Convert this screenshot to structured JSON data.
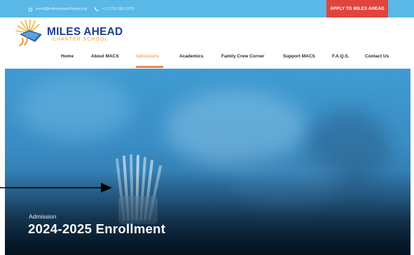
{
  "topbar": {
    "email": "enroll@milesaheadcharter.org",
    "phone": "+1 (770) 560-1670",
    "apply_label": "APPLY TO MILES AHEAD"
  },
  "logo": {
    "name": "MILES AHEAD",
    "subtitle": "CHARTER SCHOOL"
  },
  "nav": {
    "items": [
      {
        "label": "Home"
      },
      {
        "label": "About MACS"
      },
      {
        "label": "Admissions"
      },
      {
        "label": "Academics"
      },
      {
        "label": "Family Crew Corner"
      },
      {
        "label": "Support MACS"
      },
      {
        "label": "F.A.Q.S."
      },
      {
        "label": "Contact Us"
      }
    ],
    "active_index": 2
  },
  "hero": {
    "kicker": "Admission",
    "title": "2024-2025 Enrollment"
  },
  "colors": {
    "topbar": "#5ab8e6",
    "apply_button": "#e2443c",
    "brand_blue": "#1d3f8f",
    "brand_orange": "#f2a12e",
    "nav_active": "#e58b47"
  },
  "icons": [
    "home-icon",
    "phone-icon",
    "logo-sun-book-icon",
    "arrow-annotation-icon"
  ]
}
